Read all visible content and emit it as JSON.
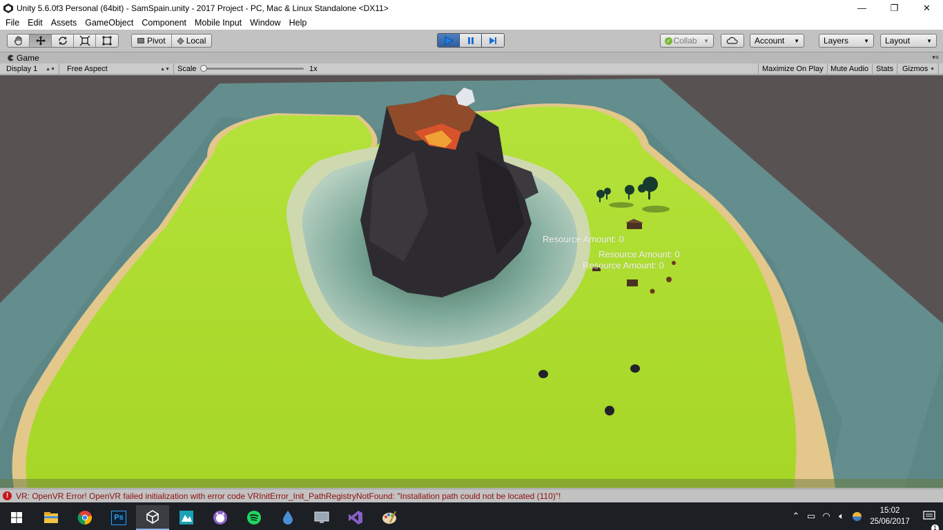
{
  "window": {
    "title": "Unity 5.6.0f3 Personal (64bit) - SamSpain.unity - 2017 Project - PC, Mac & Linux Standalone <DX11>",
    "minimize": "—",
    "maximize": "❐",
    "close": "✕"
  },
  "menu": [
    "File",
    "Edit",
    "Assets",
    "GameObject",
    "Component",
    "Mobile Input",
    "Window",
    "Help"
  ],
  "toolbar": {
    "transform_tools": [
      "hand-icon",
      "move-icon",
      "rotate-icon",
      "scale-icon",
      "rect-icon"
    ],
    "pivot_label": "Pivot",
    "local_label": "Local",
    "collab_label": "Collab",
    "account_label": "Account",
    "layers_label": "Layers",
    "layout_label": "Layout"
  },
  "game_tab": {
    "label": "Game",
    "display": "Display 1",
    "aspect": "Free Aspect",
    "scale_label": "Scale",
    "scale_value": "1x",
    "maximize_on_play": "Maximize On Play",
    "mute_audio": "Mute Audio",
    "stats": "Stats",
    "gizmos": "Gizmos"
  },
  "viewport": {
    "resource_labels": [
      "Resource Amount: 0",
      "Resource Amount: 0",
      "Resource Amount: 0"
    ],
    "colors": {
      "background": "#595252",
      "water": "#5e8a8c",
      "grass": "#a8d92a",
      "sand": "#e2c58a",
      "volcano": "#2e2c30",
      "lava": "#d7572a"
    }
  },
  "console": {
    "message": "VR: OpenVR Error! OpenVR failed initialization with error code VRInitError_Init_PathRegistryNotFound: \"Installation path could not be located (110)\"!"
  },
  "taskbar": {
    "apps": [
      "windows-start-icon",
      "file-explorer-icon",
      "chrome-icon",
      "photoshop-icon",
      "unity-icon",
      "app-icon",
      "github-icon",
      "spotify-icon",
      "drop-icon",
      "monitor-icon",
      "visual-studio-icon",
      "paint-icon"
    ],
    "photoshop_label": "Ps",
    "clock_time": "15:02",
    "clock_date": "25/06/2017",
    "notification_count": "1"
  }
}
